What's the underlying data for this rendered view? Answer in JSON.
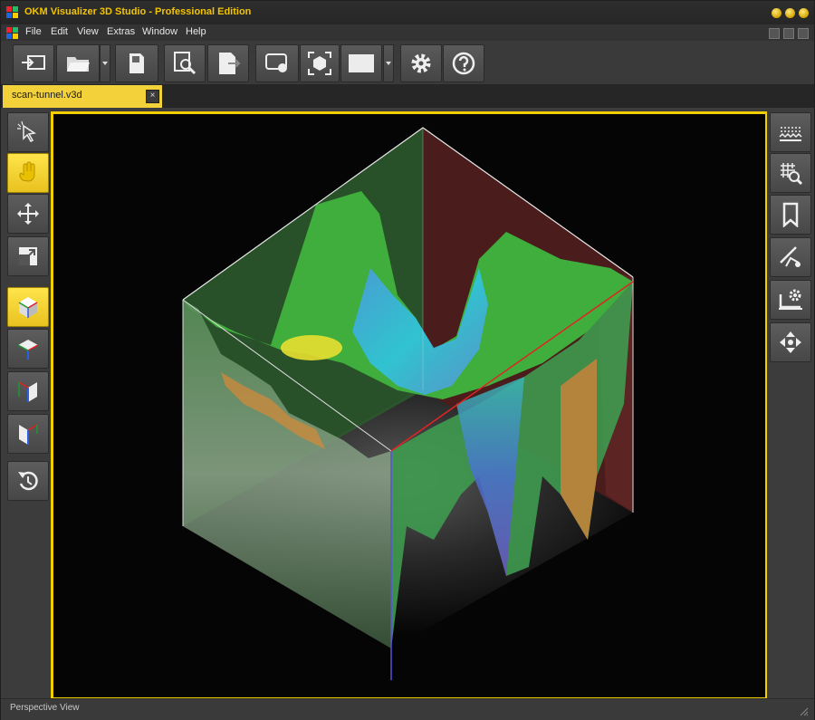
{
  "window": {
    "title": "OKM Visualizer 3D Studio - Professional Edition"
  },
  "menu": {
    "items": [
      "File",
      "Edit",
      "View",
      "Extras",
      "Window",
      "Help"
    ]
  },
  "tab": {
    "label": "scan-tunnel.v3d",
    "close_label": "×"
  },
  "status": {
    "text": "Perspective View"
  },
  "toolbar": {
    "buttons": [
      "import-icon",
      "open-folder-icon",
      "save-card-icon",
      "preview-report-icon",
      "pdf-export-icon",
      "screenshot-icon",
      "cube-selection-icon",
      "color-swatch-icon",
      "settings-gear-icon",
      "help-icon"
    ]
  },
  "left_toolbar": {
    "buttons": [
      "select-pointer-icon",
      "rotate-hand-icon",
      "move-arrows-icon",
      "resize-icon",
      "view-perspective-icon",
      "view-top-icon",
      "view-front-icon",
      "view-side-icon",
      "reset-view-icon"
    ],
    "active": [
      "rotate-hand-icon",
      "view-perspective-icon"
    ]
  },
  "right_toolbar": {
    "buttons": [
      "surface-filter-icon",
      "grid-zoom-icon",
      "bookmark-icon",
      "measure-icon",
      "screen-settings-icon",
      "center-arrows-icon"
    ]
  },
  "colors": {
    "accent": "#f2d000",
    "title": "#f2c400",
    "frame": "#3c3c3c",
    "viewport": "#050505"
  }
}
